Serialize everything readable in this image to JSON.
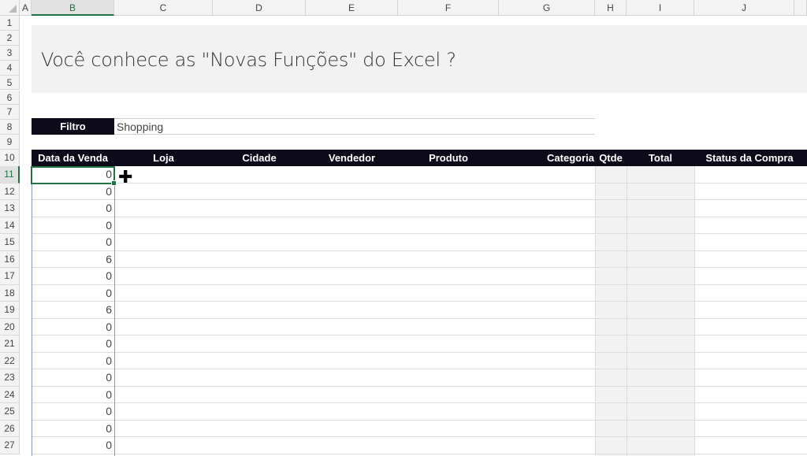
{
  "columns": [
    "A",
    "B",
    "C",
    "D",
    "E",
    "F",
    "G",
    "H",
    "I",
    "J"
  ],
  "rows": [
    "1",
    "2",
    "3",
    "4",
    "5",
    "6",
    "7",
    "8",
    "9",
    "10",
    "11",
    "12",
    "13",
    "14",
    "15",
    "16",
    "17",
    "18",
    "19",
    "20",
    "21",
    "22",
    "23",
    "24",
    "25",
    "26",
    "27"
  ],
  "title": "Você conhece as \"Novas Funções\" do Excel ?",
  "filter": {
    "label": "Filtro",
    "value": "Shopping"
  },
  "table_headers": [
    "Data da Venda",
    "Loja",
    "Cidade",
    "Vendedor",
    "Produto",
    "Categoria",
    "Qtde",
    "Total",
    "Status da Compra"
  ],
  "data_da_venda": [
    "0",
    "0",
    "0",
    "0",
    "0",
    "6",
    "0",
    "0",
    "6",
    "0",
    "0",
    "0",
    "0",
    "0",
    "0",
    "0",
    "0"
  ],
  "colors": {
    "header_bg": "#0d0a1a",
    "accent": "#217346",
    "band": "#f2f2f2"
  }
}
